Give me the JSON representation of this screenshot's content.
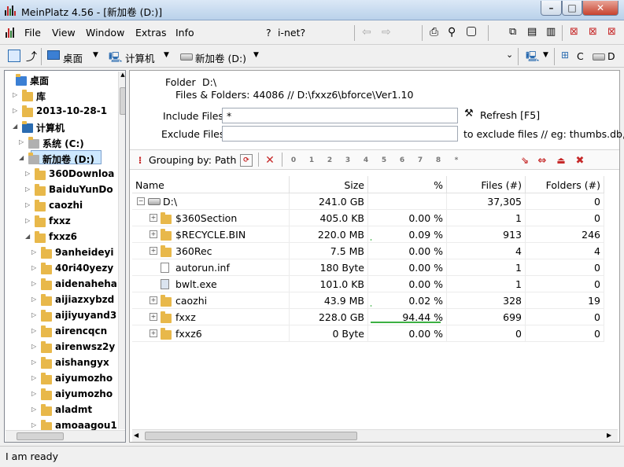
{
  "window": {
    "title": "MeinPlatz 4.56 - [新加卷 (D:)]",
    "minimize": "–",
    "maximize": "□",
    "close": "✕"
  },
  "menu": {
    "file": "File",
    "view": "View",
    "window": "Window",
    "extras": "Extras",
    "info": "Info",
    "help_q": "?",
    "inet": "i-net?"
  },
  "toolbar2": {
    "desktop": "桌面",
    "computer": "计算机",
    "drive": "新加卷 (D:)",
    "c": "C",
    "d": "D"
  },
  "tree": {
    "items": [
      {
        "label": "桌面",
        "level": 0
      },
      {
        "label": "库",
        "level": 1
      },
      {
        "label": "2013-10-28-1",
        "level": 1
      },
      {
        "label": "计算机",
        "level": 1
      },
      {
        "label": "系统 (C:)",
        "level": 2
      },
      {
        "label": "新加卷 (D:)",
        "level": 2
      },
      {
        "label": "360Downloa",
        "level": 3
      },
      {
        "label": "BaiduYunDo",
        "level": 3
      },
      {
        "label": "caozhi",
        "level": 3
      },
      {
        "label": "fxxz",
        "level": 3
      },
      {
        "label": "fxxz6",
        "level": 3
      },
      {
        "label": "9anheideyi",
        "level": 4
      },
      {
        "label": "40ri40yezy",
        "level": 4
      },
      {
        "label": "aidenaheha",
        "level": 4
      },
      {
        "label": "aijiazxybzd",
        "level": 4
      },
      {
        "label": "aijiyuyand3",
        "level": 4
      },
      {
        "label": "airencqcn",
        "level": 4
      },
      {
        "label": "airenwsz2y",
        "level": 4
      },
      {
        "label": "aishangyx",
        "level": 4
      },
      {
        "label": "aiyumozho",
        "level": 4
      },
      {
        "label": "aiyumozho",
        "level": 4
      },
      {
        "label": "aladmt",
        "level": 4
      },
      {
        "label": "amoaagou1",
        "level": 4
      }
    ]
  },
  "info": {
    "folder_label": "Folder",
    "folder_value": "D:\\",
    "files_folders": "Files & Folders: 44086 // D:\\fxxz6\\bforce\\Ver1.10",
    "include_label": "Include Files",
    "include_value": "*",
    "exclude_label": "Exclude Files",
    "exclude_value": "",
    "refresh": "Refresh [F5]",
    "exclude_hint": "to exclude files // eg: thumbs.db,*"
  },
  "grouping": {
    "label": "Grouping by: Path",
    "levels": [
      "0",
      "1",
      "2",
      "3",
      "4",
      "5",
      "6",
      "7",
      "8",
      "*"
    ]
  },
  "table": {
    "headers": {
      "name": "Name",
      "size": "Size",
      "pct": "%",
      "files": "Files (#)",
      "folders": "Folders (#)"
    },
    "rows": [
      {
        "name": "D:\\",
        "size": "241.0 GB",
        "pct": "",
        "files": "37,305",
        "folders": "0",
        "kind": "drive",
        "pct_value": 0
      },
      {
        "name": "$360Section",
        "size": "405.0 KB",
        "pct": "0.00 %",
        "files": "1",
        "folders": "0",
        "kind": "folder",
        "pct_value": 0
      },
      {
        "name": "$RECYCLE.BIN",
        "size": "220.0 MB",
        "pct": "0.09 %",
        "files": "913",
        "folders": "246",
        "kind": "folder",
        "pct_value": 0.09
      },
      {
        "name": "360Rec",
        "size": "7.5 MB",
        "pct": "0.00 %",
        "files": "4",
        "folders": "4",
        "kind": "folder",
        "pct_value": 0
      },
      {
        "name": "autorun.inf",
        "size": "180 Byte",
        "pct": "0.00 %",
        "files": "1",
        "folders": "0",
        "kind": "file",
        "pct_value": 0
      },
      {
        "name": "bwlt.exe",
        "size": "101.0 KB",
        "pct": "0.00 %",
        "files": "1",
        "folders": "0",
        "kind": "exe",
        "pct_value": 0
      },
      {
        "name": "caozhi",
        "size": "43.9 MB",
        "pct": "0.02 %",
        "files": "328",
        "folders": "19",
        "kind": "folder",
        "pct_value": 0.02
      },
      {
        "name": "fxxz",
        "size": "228.0 GB",
        "pct": "94.44 %",
        "files": "699",
        "folders": "0",
        "kind": "folder",
        "pct_value": 94.44
      },
      {
        "name": "fxxz6",
        "size": "0 Byte",
        "pct": "0.00 %",
        "files": "0",
        "folders": "0",
        "kind": "folder",
        "pct_value": 0
      }
    ]
  },
  "status": {
    "text": "I am ready"
  }
}
